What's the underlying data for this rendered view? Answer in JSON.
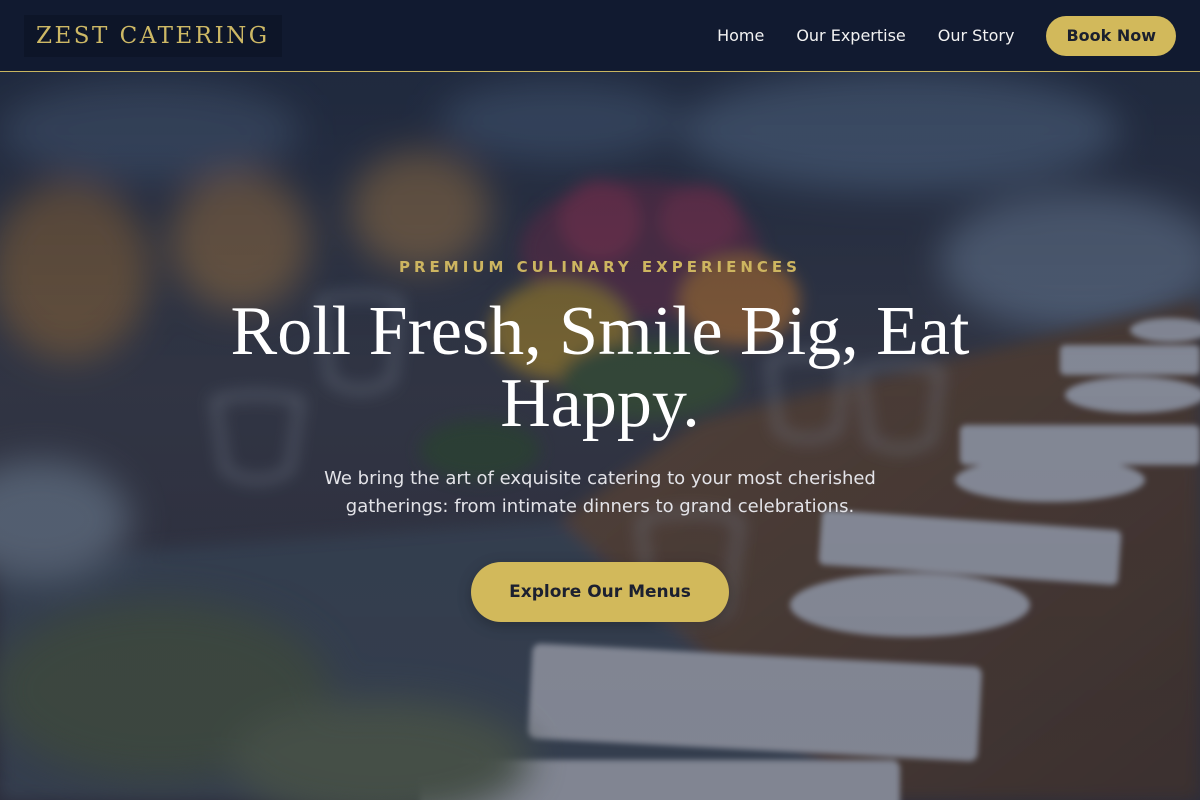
{
  "brand": {
    "name": "ZEST CATERING"
  },
  "nav": {
    "links": [
      {
        "label": "Home"
      },
      {
        "label": "Our Expertise"
      },
      {
        "label": "Our Story"
      }
    ],
    "cta_label": "Book Now"
  },
  "hero": {
    "eyebrow": "PREMIUM CULINARY EXPERIENCES",
    "headline": "Roll Fresh, Smile Big, Eat Happy.",
    "subtext": "We bring the art of exquisite catering to your most cherished gatherings: from intimate dinners to grand celebrations.",
    "cta_label": "Explore Our Menus"
  },
  "colors": {
    "accent_gold": "#d2b95b",
    "navbar_bg": "#111a30",
    "headline_text": "#ffffff"
  }
}
